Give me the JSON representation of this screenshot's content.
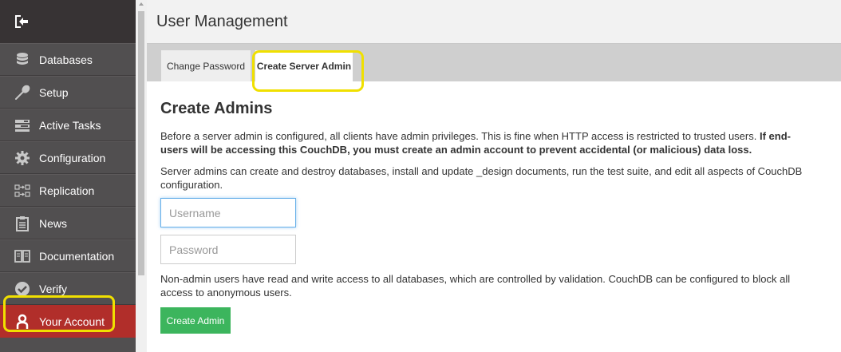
{
  "sidebar": {
    "collapse_icon": "sign-out-icon",
    "items": [
      {
        "label": "Databases",
        "icon": "database-icon"
      },
      {
        "label": "Setup",
        "icon": "wrench-icon"
      },
      {
        "label": "Active Tasks",
        "icon": "tasks-icon"
      },
      {
        "label": "Configuration",
        "icon": "gear-icon"
      },
      {
        "label": "Replication",
        "icon": "replication-icon"
      },
      {
        "label": "News",
        "icon": "clipboard-icon"
      },
      {
        "label": "Documentation",
        "icon": "book-icon"
      },
      {
        "label": "Verify",
        "icon": "check-circle-icon"
      },
      {
        "label": "Your Account",
        "icon": "user-icon",
        "active": true
      }
    ],
    "active_color": "#b12e2a"
  },
  "header": {
    "title": "User Management"
  },
  "tabs": [
    {
      "label": "Change Password"
    },
    {
      "label": "Create Server Admin",
      "active": true
    }
  ],
  "content": {
    "title": "Create Admins",
    "intro": "Before a server admin is configured, all clients have admin privileges. This is fine when HTTP access is restricted to trusted users.",
    "intro_bold": "If end-users will be accessing this CouchDB, you must create an admin account to prevent accidental (or malicious) data loss.",
    "capabilities": "Server admins can create and destroy databases, install and update _design documents, run the test suite, and edit all aspects of CouchDB configuration.",
    "username_placeholder": "Username",
    "password_placeholder": "Password",
    "non_admin_note": "Non-admin users have read and write access to all databases, which are controlled by validation. CouchDB can be configured to block all access to anonymous users.",
    "create_button": "Create Admin"
  },
  "colors": {
    "highlight": "#f0e000",
    "button": "#3cb55d"
  }
}
